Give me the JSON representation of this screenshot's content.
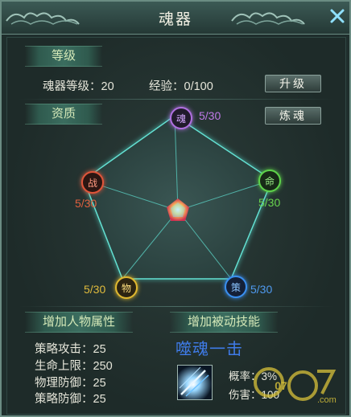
{
  "window": {
    "title": "魂器"
  },
  "level_section": {
    "tag": "等级",
    "level_label": "魂器等级：20",
    "exp_label": "经验：0/100",
    "upgrade_button": "升级"
  },
  "quality_section": {
    "tag": "资质",
    "refine_button": "炼魂",
    "nodes": [
      {
        "id": "hun",
        "glyph": "魂",
        "value": "5/30",
        "color": "#b070e0"
      },
      {
        "id": "ming",
        "glyph": "命",
        "value": "5/30",
        "color": "#5ed24a"
      },
      {
        "id": "ce",
        "glyph": "策",
        "value": "5/30",
        "color": "#3a8ff0"
      },
      {
        "id": "wu",
        "glyph": "物",
        "value": "5/30",
        "color": "#e0b830"
      },
      {
        "id": "zhan",
        "glyph": "战",
        "value": "5/30",
        "color": "#e0553a"
      }
    ]
  },
  "attr_section": {
    "tag": "增加人物属性",
    "items": [
      "策略攻击：25",
      "生命上限：250",
      "物理防御：25",
      "策略防御：25"
    ]
  },
  "skill_section": {
    "tag": "增加被动技能",
    "skill_name": "噬魂一击",
    "rate": "概率：3%",
    "damage": "伤害：100"
  },
  "watermark": {
    "text": "07",
    "domain": ".com"
  }
}
